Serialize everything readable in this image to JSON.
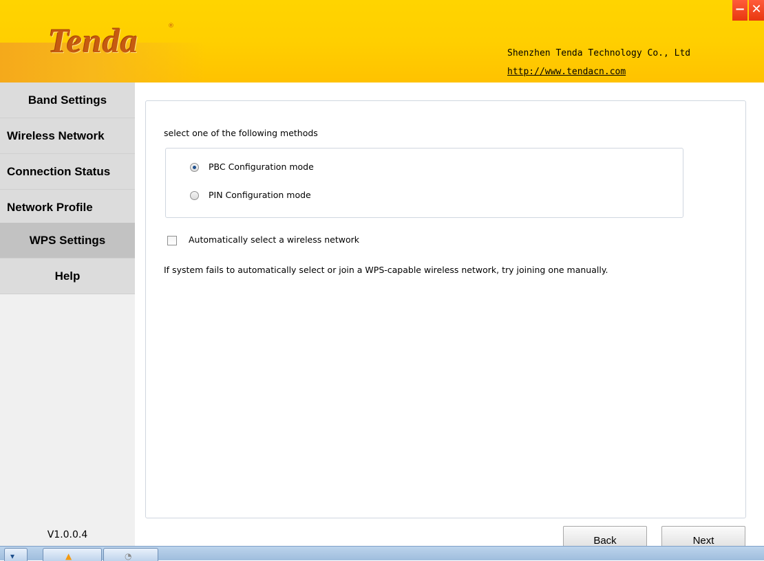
{
  "header": {
    "logo": "Tenda",
    "logo_mark": "®",
    "company": "Shenzhen Tenda Technology Co., Ltd",
    "url": "http://www.tendacn.com",
    "minimize_label": "−",
    "close_label": "✕"
  },
  "sidebar": {
    "items": [
      {
        "label": "Band Settings"
      },
      {
        "label": "Wireless Network"
      },
      {
        "label": "Connection Status"
      },
      {
        "label": "Network Profile"
      },
      {
        "label": "WPS Settings",
        "active": true
      },
      {
        "label": "Help"
      }
    ],
    "version": "V1.0.0.4"
  },
  "main": {
    "instruction": "select one of the following methods",
    "methods": [
      {
        "label": "PBC Configuration mode",
        "selected": true
      },
      {
        "label": "PIN Configuration mode",
        "selected": false
      }
    ],
    "auto_select": {
      "label": "Automatically select a wireless network",
      "checked": false
    },
    "hint": "If system fails to automatically select or join a WPS-capable wireless network, try joining one manually."
  },
  "buttons": {
    "back": "Back",
    "next": "Next"
  },
  "colors": {
    "header_yellow": "#ffcf00",
    "header_orange": "#f5a91b",
    "logo": "#c65b10",
    "sidebar_bg": "#dcdcdc",
    "sidebar_active": "#c2c2c2",
    "close_red": "#e8380f"
  },
  "icons": {
    "minimize": "minimize-icon",
    "close": "close-icon",
    "taskbar_app1": "tenda-app-icon",
    "taskbar_app2": "app-icon"
  }
}
